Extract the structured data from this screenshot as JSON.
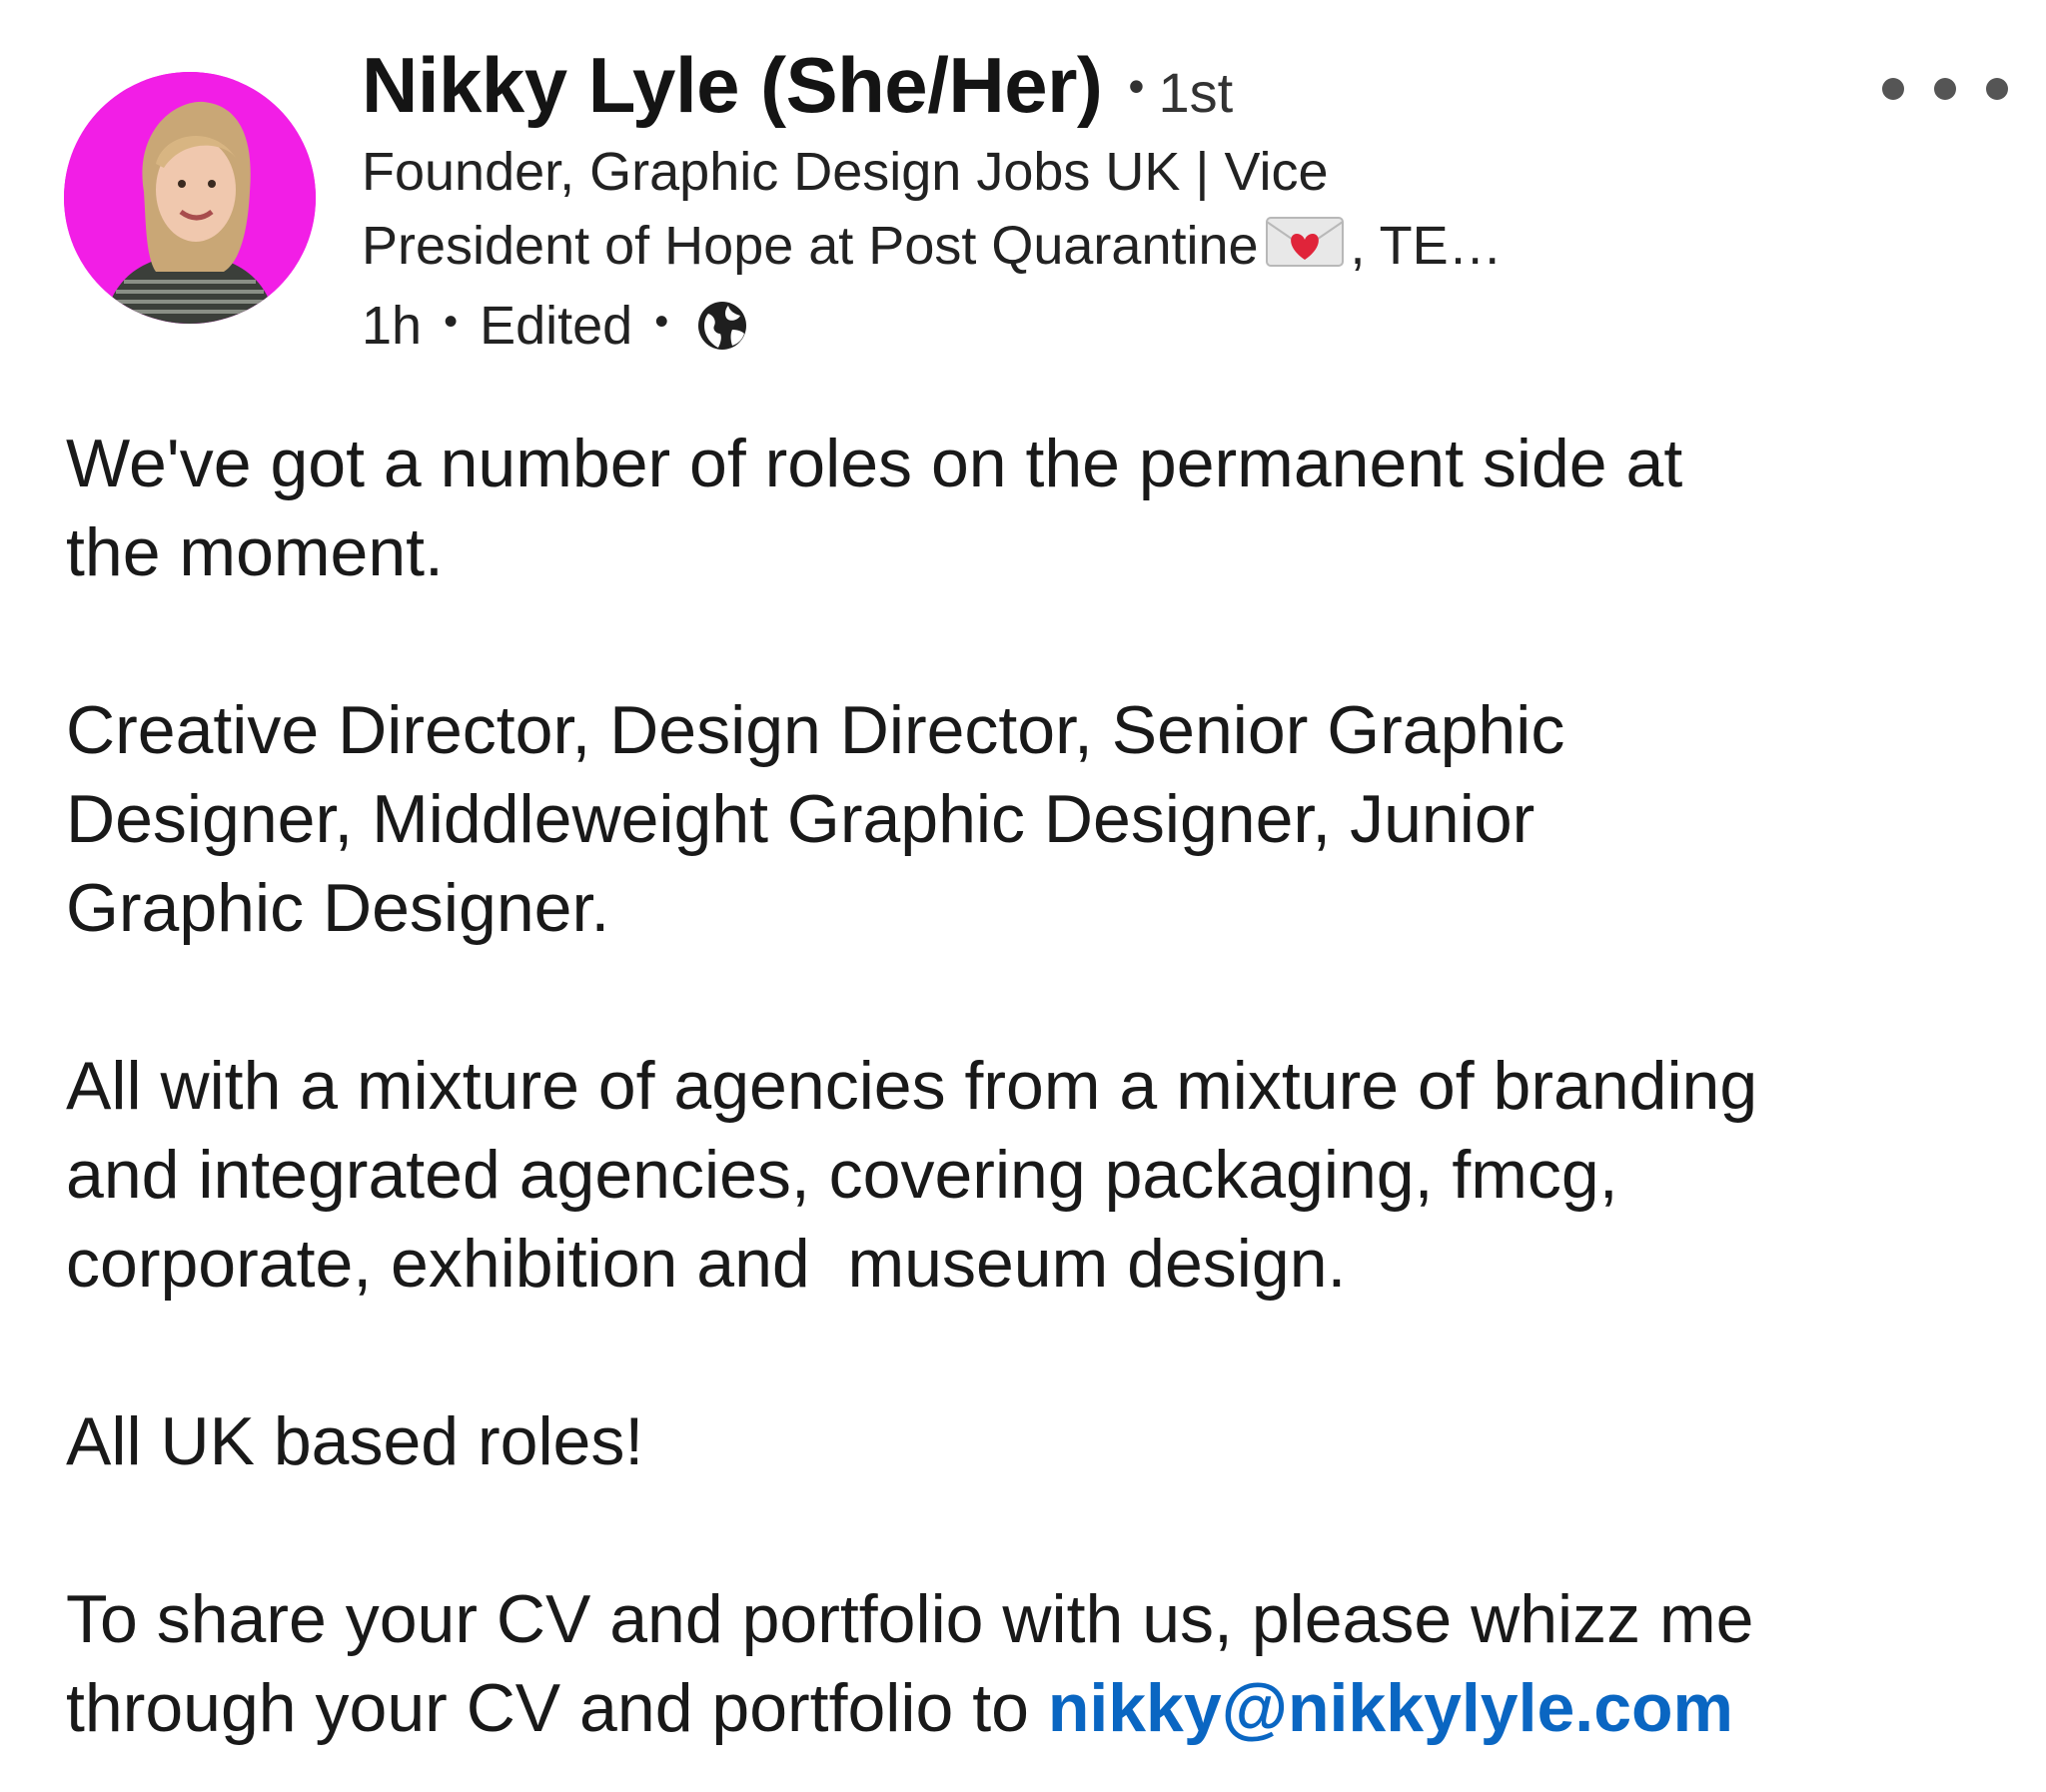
{
  "post": {
    "author": {
      "name": "Nikky Lyle (She/Her)",
      "separator": "•",
      "degree": "1st",
      "headline_line1": "Founder, Graphic Design Jobs UK | Vice",
      "headline_line2_a": "President of Hope at Post Quarantine",
      "headline_emoji": "love-letter-emoji",
      "headline_line2_b": ", TE…"
    },
    "meta": {
      "time": "1h",
      "dot": "•",
      "edited": "Edited",
      "visibility_icon": "globe-icon"
    },
    "more_icon": "ellipsis-icon",
    "body": {
      "p1": "We've got a number of roles on the permanent side at\nthe moment.",
      "p2": "Creative Director, Design Director, Senior Graphic\nDesigner, Middleweight Graphic Designer, Junior\nGraphic Designer.",
      "p3": "All with a mixture of agencies from a mixture of branding\nand integrated agencies, covering packaging, fmcg,\ncorporate, exhibition and  museum design.",
      "p4": "All UK based roles!",
      "p5": "To share your CV and portfolio with us, please whizz me\nthrough your CV and portfolio to ",
      "email": "nikky@nikkylyle.com"
    },
    "colors": {
      "avatar_bg": "#f21ee6",
      "link": "#0a66c2"
    }
  }
}
